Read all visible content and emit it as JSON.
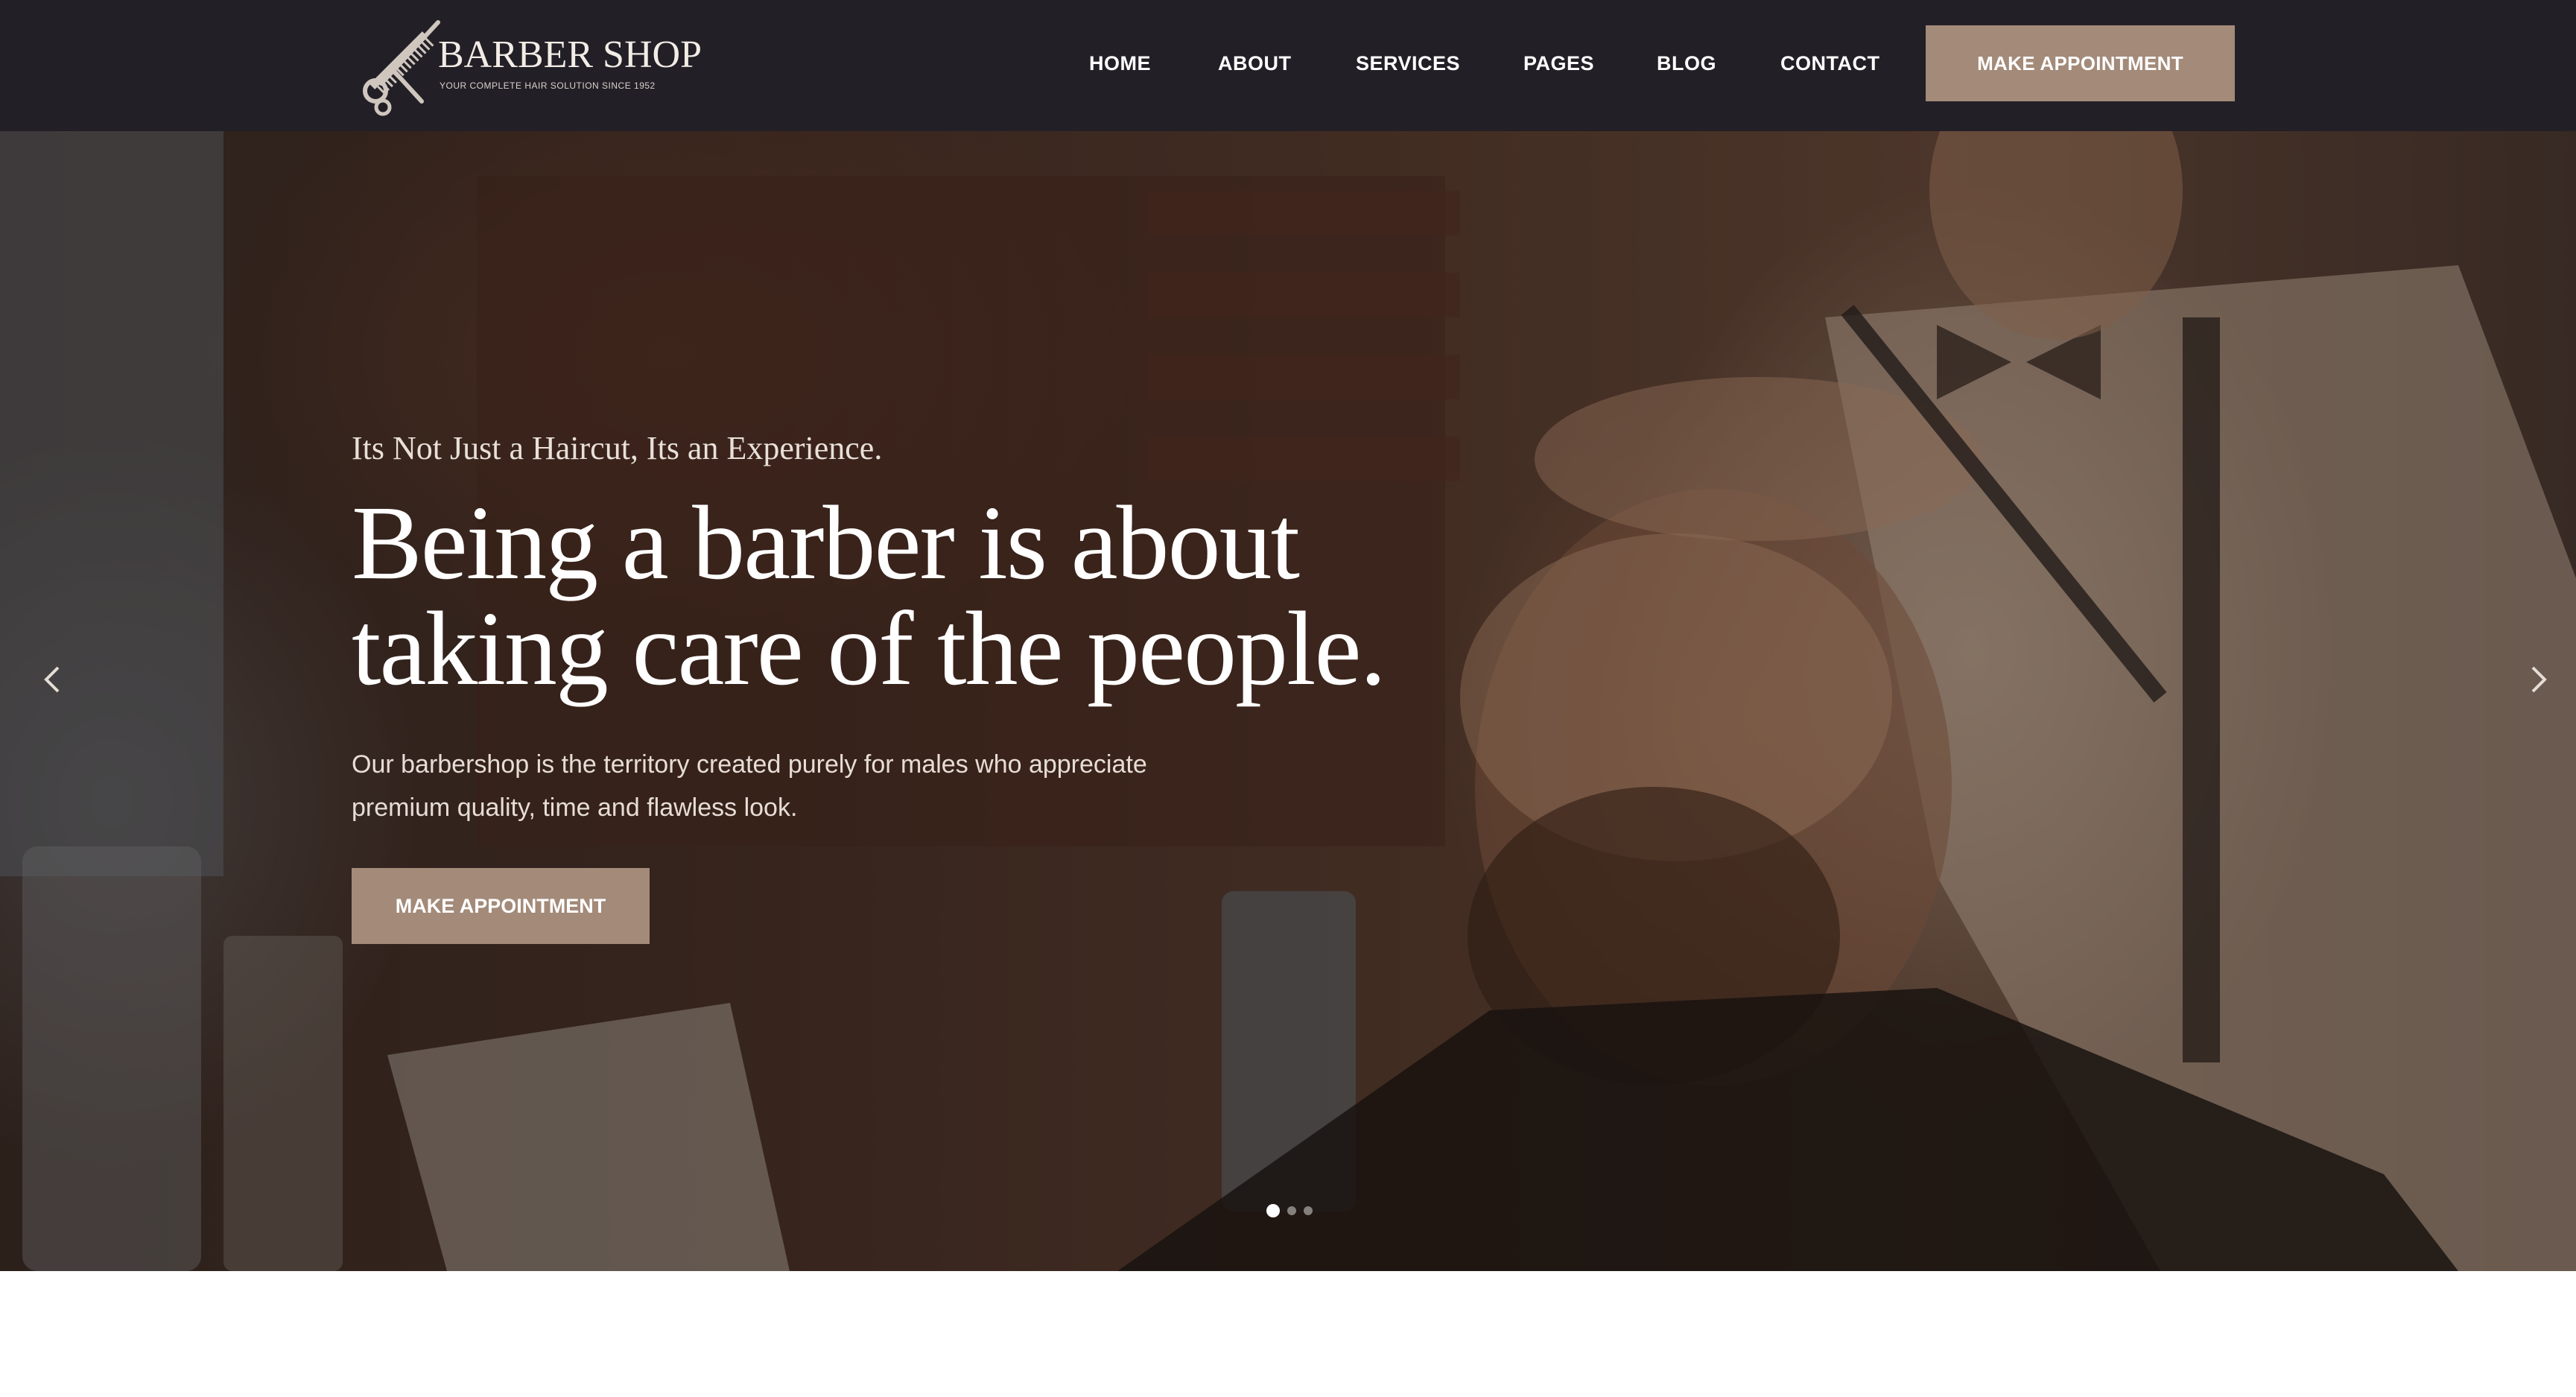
{
  "brand": {
    "title": "BARBER SHOP",
    "tagline": "YOUR COMPLETE HAIR SOLUTION SINCE 1952",
    "icon": "scissors-comb-icon",
    "accent": "#a38a79",
    "header_bg": "#221f26"
  },
  "nav": {
    "items": [
      {
        "label": "HOME"
      },
      {
        "label": "ABOUT"
      },
      {
        "label": "SERVICES"
      },
      {
        "label": "PAGES"
      },
      {
        "label": "BLOG"
      },
      {
        "label": "CONTACT"
      }
    ],
    "cta": "MAKE APPOINTMENT"
  },
  "hero": {
    "tagline": "Its Not Just a Haircut, Its an Experience.",
    "headline_line1": "Being a barber is about",
    "headline_line2": "taking care of the people.",
    "description": "Our barbershop is the territory created purely for males who appreciate premium quality, time and flawless look.",
    "cta": "MAKE APPOINTMENT",
    "prev_icon": "chevron-left-icon",
    "next_icon": "chevron-right-icon",
    "slides_total": 3,
    "active_slide": 1
  }
}
